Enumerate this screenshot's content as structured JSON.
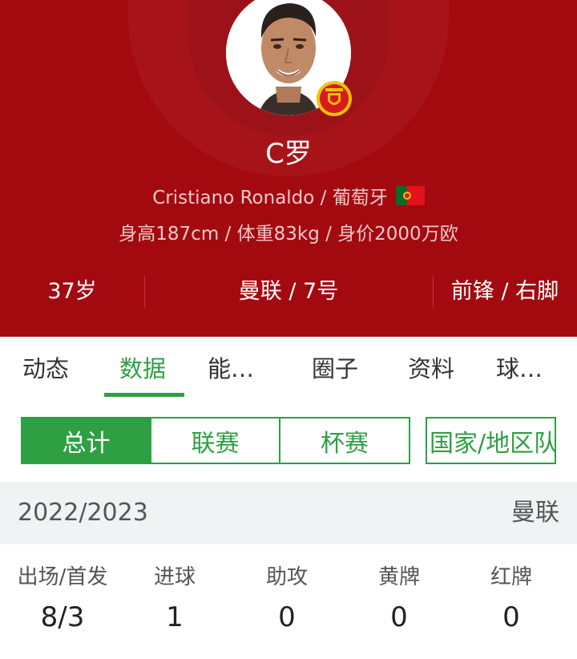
{
  "header": {
    "name": "C罗",
    "subtitle": "Cristiano Ronaldo / 葡萄牙",
    "info": "身高187cm / 体重83kg / 身价2000万欧",
    "stats": [
      "37岁",
      "曼联 / 7号",
      "前锋 / 右脚"
    ],
    "avatar_icon": "player-photo",
    "badge_icon": "manchester-united-badge",
    "flag_icon": "portugal-flag"
  },
  "tabs": [
    {
      "label": "动态",
      "active": false
    },
    {
      "label": "数据",
      "active": true
    },
    {
      "label": "能…",
      "active": false
    },
    {
      "label": "圈子",
      "active": false
    },
    {
      "label": "资料",
      "active": false
    },
    {
      "label": "球…",
      "active": false
    }
  ],
  "segments": [
    {
      "label": "总计",
      "active": true
    },
    {
      "label": "联赛",
      "active": false
    },
    {
      "label": "杯赛",
      "active": false
    },
    {
      "label": "国家/地区队",
      "active": false
    }
  ],
  "season": {
    "year": "2022/2023",
    "club": "曼联"
  },
  "stat_columns": [
    {
      "label": "出场/首发",
      "value": "8/3"
    },
    {
      "label": "进球",
      "value": "1"
    },
    {
      "label": "助攻",
      "value": "0"
    },
    {
      "label": "黄牌",
      "value": "0"
    },
    {
      "label": "红牌",
      "value": "0"
    }
  ],
  "colors": {
    "header_bg": "#a30a10",
    "accent": "#2ea043",
    "season_bg": "#f1f2f4"
  }
}
